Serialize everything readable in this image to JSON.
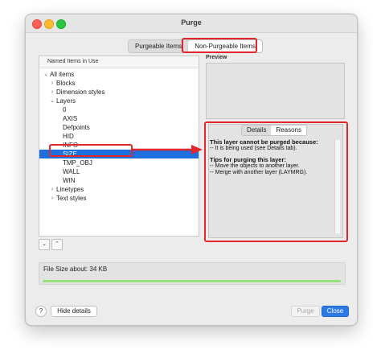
{
  "window": {
    "title": "Purge"
  },
  "tabs": [
    {
      "label": "Purgeable Items",
      "active": false
    },
    {
      "label": "Non-Purgeable Items",
      "active": true
    }
  ],
  "tree": {
    "header": "Named Items in Use",
    "rows": [
      {
        "label": "All items",
        "chevron": "⌄",
        "level": 0
      },
      {
        "label": "Blocks",
        "chevron": "›",
        "level": 1
      },
      {
        "label": "Dimension styles",
        "chevron": "›",
        "level": 1
      },
      {
        "label": "Layers",
        "chevron": "⌄",
        "level": 1
      },
      {
        "label": "0",
        "chevron": "",
        "level": 2
      },
      {
        "label": "AXIS",
        "chevron": "",
        "level": 2
      },
      {
        "label": "Defpoints",
        "chevron": "",
        "level": 2
      },
      {
        "label": "HID",
        "chevron": "",
        "level": 2
      },
      {
        "label": "INFO",
        "chevron": "",
        "level": 2
      },
      {
        "label": "SIZE",
        "chevron": "",
        "level": 2,
        "selected": true
      },
      {
        "label": "TMP_OBJ",
        "chevron": "",
        "level": 2
      },
      {
        "label": "WALL",
        "chevron": "",
        "level": 2
      },
      {
        "label": "WIN",
        "chevron": "",
        "level": 2
      },
      {
        "label": "Linetypes",
        "chevron": "›",
        "level": 1
      },
      {
        "label": "Text styles",
        "chevron": "›",
        "level": 1
      }
    ]
  },
  "sort_buttons": {
    "expand_icon": "expand-all-icon",
    "collapse_icon": "collapse-all-icon",
    "expand_glyph": "⌄",
    "collapse_glyph": "⌃"
  },
  "preview": {
    "label": "Preview"
  },
  "details": {
    "tabs": [
      {
        "label": "Details",
        "active": false
      },
      {
        "label": "Reasons",
        "active": true
      }
    ],
    "heading1": "This layer cannot be purged because:",
    "line1": "-- It is being used (see Details tab).",
    "heading2": "Tips for purging this layer:",
    "line2": "-- Move the objects to another layer.",
    "line3": "-- Merge with another layer (LAYMRG)."
  },
  "file_size": {
    "label": "File Size about: 34 KB",
    "progress": 1.0
  },
  "buttons": {
    "help": "?",
    "hide_details": "Hide details",
    "purge": "Purge",
    "close": "Close"
  },
  "colors": {
    "annotation": "#e0272e",
    "selection": "#1d6fde",
    "progress": "#98e07a",
    "primary_button": "#2c7be5"
  }
}
